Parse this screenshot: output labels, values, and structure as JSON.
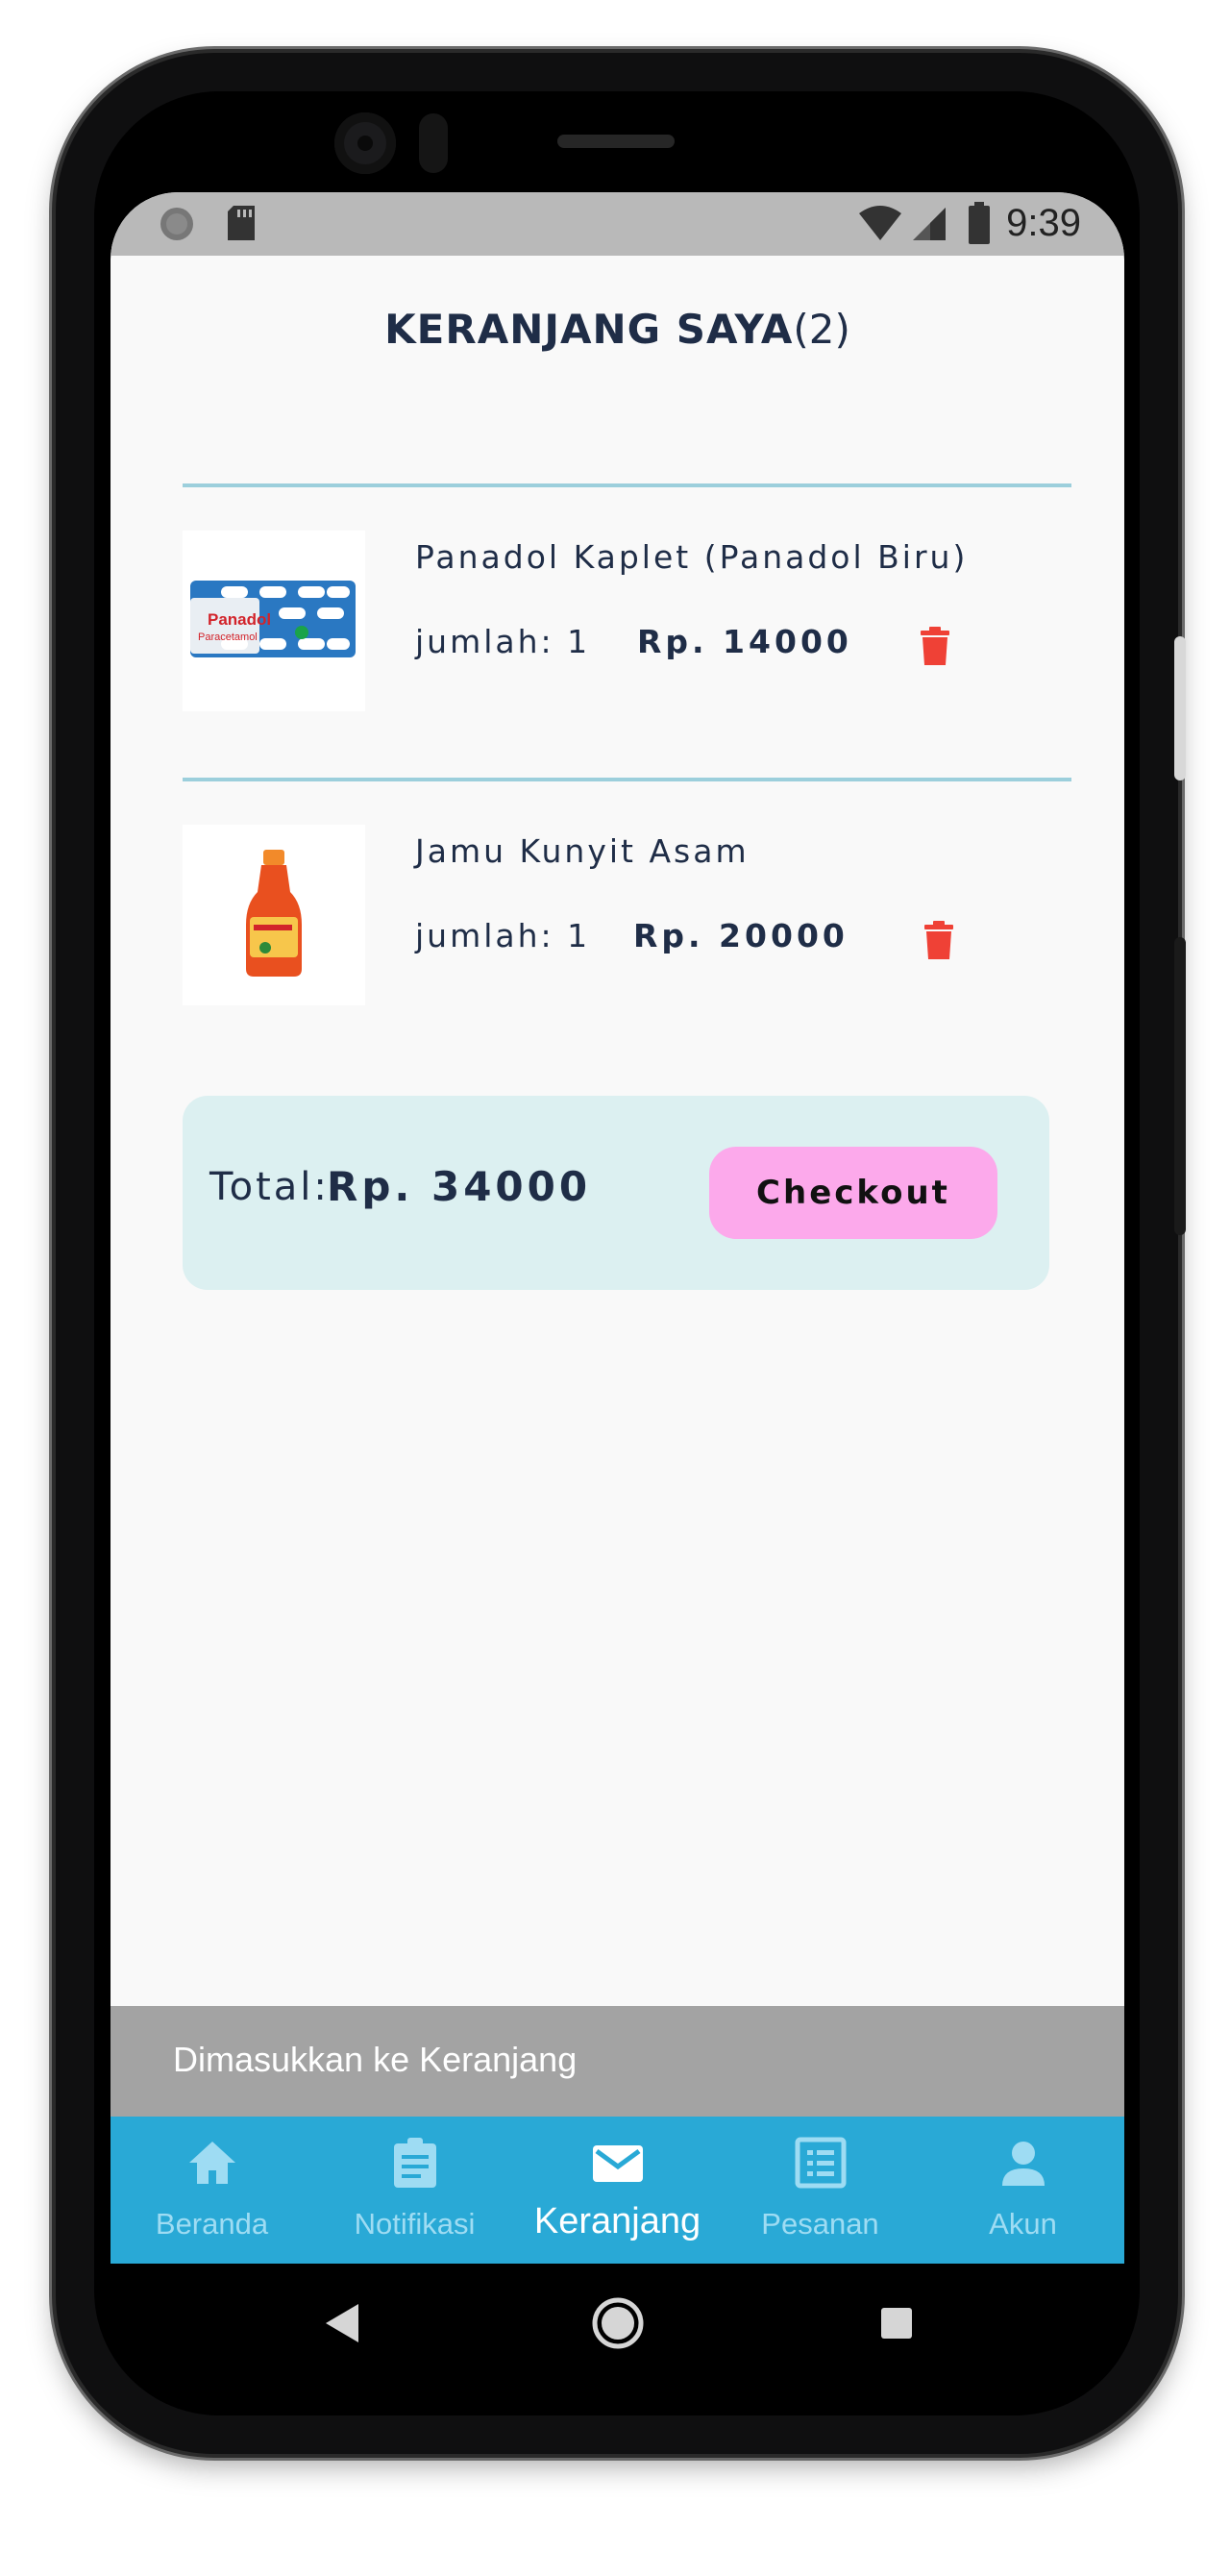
{
  "status_bar": {
    "time": "9:39"
  },
  "page": {
    "title": "KERANJANG SAYA",
    "count": "(2)"
  },
  "cart_items": [
    {
      "name": "Panadol Kaplet (Panadol Biru)",
      "qty": "jumlah: 1",
      "price": "Rp. 14000",
      "image_text": "Panadol Paracetamol"
    },
    {
      "name": "Jamu Kunyit Asam",
      "qty": "jumlah: 1",
      "price": "Rp. 20000"
    }
  ],
  "summary": {
    "total_label": "Total:",
    "total_value": "Rp. 34000",
    "checkout_label": "Checkout"
  },
  "snackbar": {
    "message": "Dimasukkan ke Keranjang"
  },
  "bottom_nav": {
    "items": [
      {
        "label": "Beranda",
        "icon": "home-icon"
      },
      {
        "label": "Notifikasi",
        "icon": "clipboard-icon"
      },
      {
        "label": "Keranjang",
        "icon": "mail-icon",
        "active": true
      },
      {
        "label": "Pesanan",
        "icon": "list-icon"
      },
      {
        "label": "Akun",
        "icon": "person-icon"
      }
    ]
  },
  "colors": {
    "primary_text": "#1f2d47",
    "nav_bar": "#29a9d6",
    "checkout_button": "#fca9eb",
    "total_box": "#dcf0f1",
    "delete_icon": "#ef4136",
    "divider": "#9ccfdc"
  }
}
